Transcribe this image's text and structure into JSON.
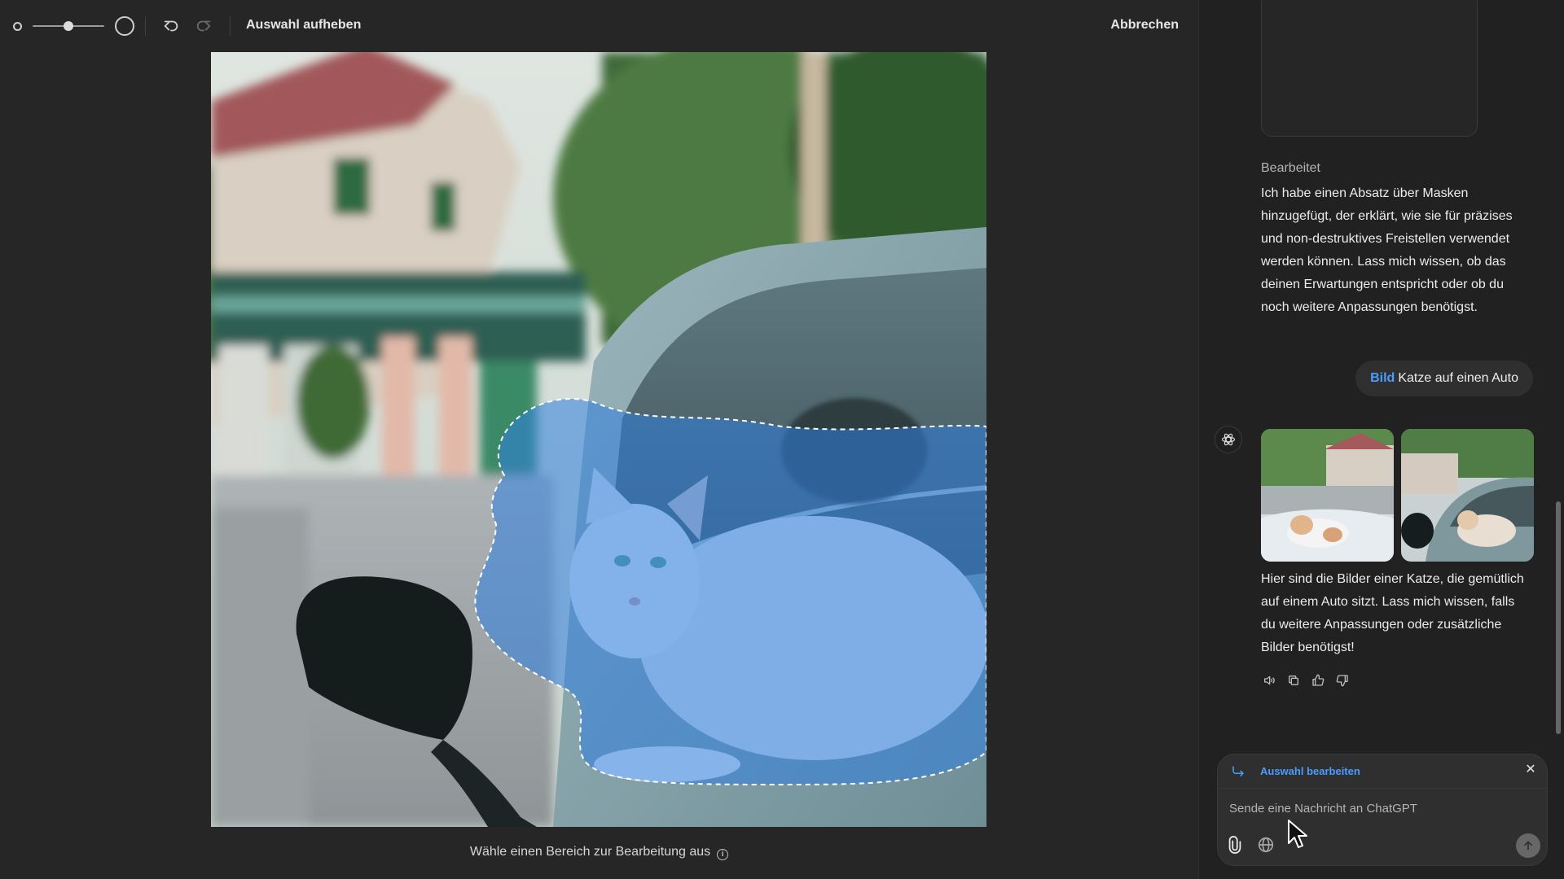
{
  "toolbar": {
    "deselect_label": "Auswahl aufheben",
    "cancel_label": "Abbrechen",
    "brush_size_fraction": 0.5
  },
  "editor": {
    "hint_text": "Wähle einen Bereich zur Bearbeitung aus",
    "info_glyph": "i"
  },
  "chat": {
    "edited_label": "Bearbeitet",
    "assistant_message_1": "Ich habe einen Absatz über Masken hinzugefügt, der erklärt, wie sie für präzises und non-destruktives Freistellen verwendet werden können. Lass mich wissen, ob das deinen Erwartungen entspricht oder ob du noch weitere Anpassungen benötigst.",
    "user_tag": "Bild",
    "user_message": "Katze auf einen Auto",
    "assistant_message_2": "Hier sind die Bilder einer Katze, die gemütlich auf einem Auto sitzt. Lass mich wissen, falls du weitere Anpassungen oder zusätzliche Bilder benötigst!",
    "actions": [
      "speaker-icon",
      "copy-icon",
      "thumbs-up-icon",
      "thumbs-down-icon"
    ]
  },
  "composer": {
    "edit_selection_label": "Auswahl bearbeiten",
    "close_glyph": "✕",
    "placeholder": "Sende eine Nachricht an ChatGPT"
  },
  "colors": {
    "accent": "#4b9cff",
    "mask": "#2f7fe0",
    "background": "#212121"
  }
}
